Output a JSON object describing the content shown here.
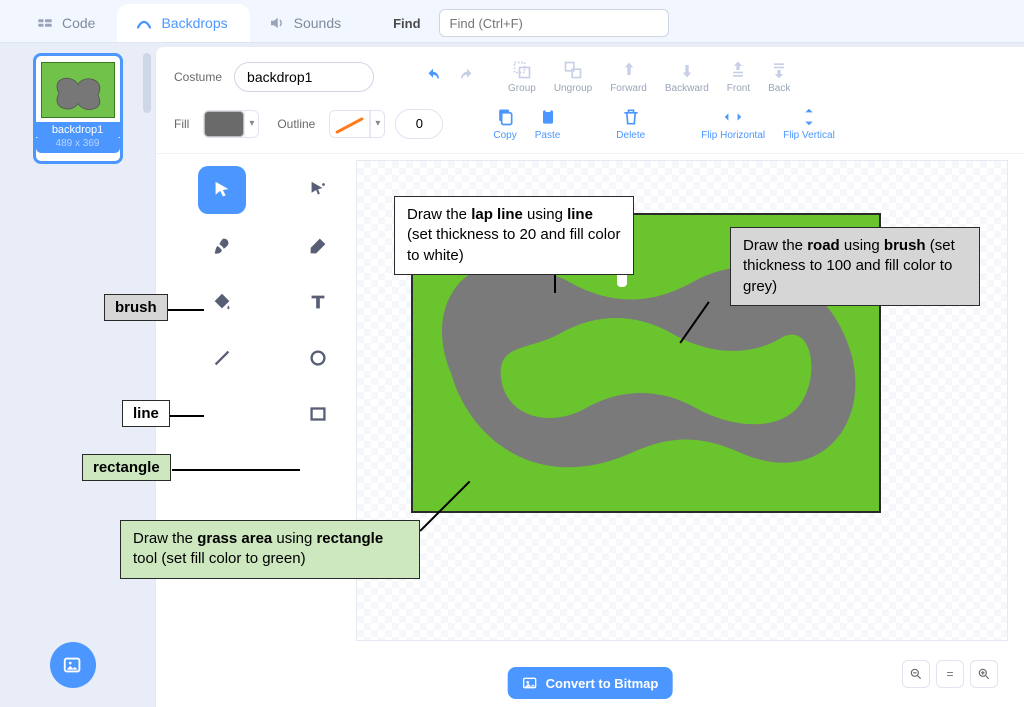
{
  "tabs": {
    "code": "Code",
    "backdrops": "Backdrops",
    "sounds": "Sounds"
  },
  "find": {
    "label": "Find",
    "placeholder": "Find (Ctrl+F)"
  },
  "costume": {
    "label": "Costume",
    "name": "backdrop1",
    "thumb_name": "backdrop1",
    "thumb_dim": "489 x 369"
  },
  "toolbar": {
    "group": "Group",
    "ungroup": "Ungroup",
    "forward": "Forward",
    "backward": "Backward",
    "front": "Front",
    "back": "Back",
    "copy": "Copy",
    "paste": "Paste",
    "delete": "Delete",
    "fliph": "Flip Horizontal",
    "flipv": "Flip Vertical"
  },
  "fill": {
    "label": "Fill",
    "color": "#6a6a6a"
  },
  "outline": {
    "label": "Outline",
    "width": "0"
  },
  "convert": "Convert to Bitmap",
  "annotations": {
    "brush_tag": "brush",
    "line_tag": "line",
    "rect_tag": "rectangle",
    "lap_a": "Draw the ",
    "lap_b": "lap line",
    "lap_c": " using ",
    "lap_d": "line",
    "lap_e": " (set thickness to 20 and fill color to white)",
    "road_a": "Draw the ",
    "road_b": "road",
    "road_c": " using ",
    "road_d": "brush",
    "road_e": " (set thickness to 100 and fill color to grey)",
    "grass_a": "Draw the ",
    "grass_b": "grass area",
    "grass_c": " using ",
    "grass_d": "rectangle",
    "grass_e": " tool (set fill color to green)"
  }
}
